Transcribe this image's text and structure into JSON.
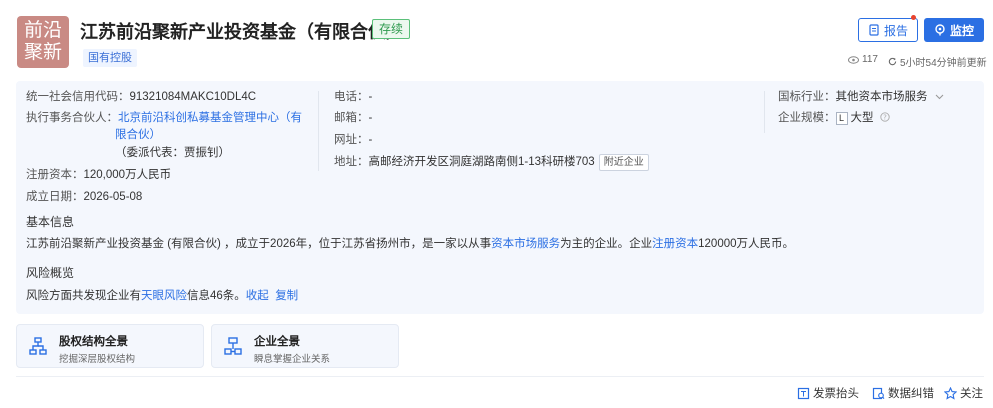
{
  "logo": {
    "line1": "前沿",
    "line2": "聚新",
    "bg_color": "#c98a84"
  },
  "company": {
    "name": "江苏前沿聚新产业投资基金（有限合伙）",
    "status": "存续",
    "tag": "国有控股"
  },
  "actions": {
    "report_label": "报告",
    "monitor_label": "监控"
  },
  "meta": {
    "views": "117",
    "update_text": "5小时54分钟前更新"
  },
  "info": {
    "credit_code_label": "统一社会信用代码：",
    "credit_code": "91321084MAKC10DL4C",
    "partner_label": "执行事务合伙人：",
    "partner_line1": "北京前沿科创私募基金管理中心（有",
    "partner_line2": "限合伙）",
    "partner_rep": "（委派代表：贾振钊）",
    "capital_label": "注册资本：",
    "capital": "120,000万人民币",
    "founded_label": "成立日期：",
    "founded": "2026-05-08",
    "phone_label": "电话：",
    "phone": "-",
    "email_label": "邮箱：",
    "email": "-",
    "website_label": "网址：",
    "website": "-",
    "address_label": "地址：",
    "address": "高邮经济开发区洞庭湖路南侧1-13科研楼703",
    "nearby_label": "附近企业",
    "industry_label": "国标行业：",
    "industry": "其他资本市场服务",
    "scale_label": "企业规模：",
    "scale_letter": "L",
    "scale": "大型"
  },
  "basic": {
    "title": "基本信息",
    "seg1": "江苏前沿聚新产业投资基金 (有限合伙) ，成立于2026年，位于江苏省扬州市，是一家以从事",
    "seg2": "资本市场服务",
    "seg3": "为主的企业。企业",
    "seg4": "注册资本",
    "seg5": "120000万人民币。"
  },
  "risk": {
    "title": "风险概览",
    "seg1": "风险方面共发现企业有",
    "seg2": "天眼风险",
    "seg3": "信息46条。",
    "collapse": "收起",
    "copy": "复制"
  },
  "cards": [
    {
      "title": "股权结构全景",
      "sub": "挖掘深层股权结构"
    },
    {
      "title": "企业全景",
      "sub": "瞬息掌握企业关系"
    }
  ],
  "footer": {
    "invoice": "发票抬头",
    "correction": "数据纠错",
    "follow": "关注"
  }
}
